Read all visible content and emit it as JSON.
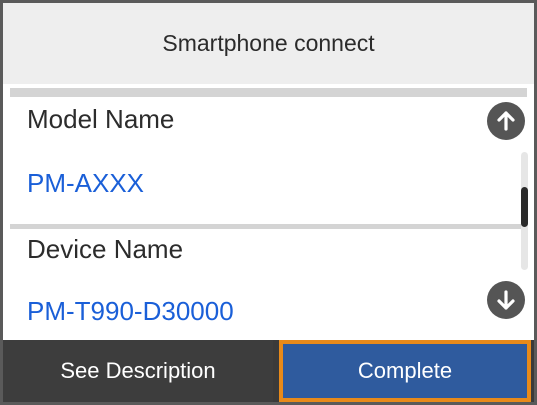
{
  "header": {
    "title": "Smartphone connect"
  },
  "fields": [
    {
      "label": "Model Name",
      "value": "PM-AXXX"
    },
    {
      "label": "Device Name",
      "value": "PM-T990-D30000"
    }
  ],
  "icons": {
    "scroll_up": "arrow-up-icon",
    "scroll_down": "arrow-down-icon"
  },
  "buttons": {
    "description": "See Description",
    "complete": "Complete"
  },
  "colors": {
    "value_text": "#1a5fd8",
    "complete_button": "#2f5b9e",
    "focus_border": "#e88a1a",
    "dark_button": "#3d3d3d"
  }
}
